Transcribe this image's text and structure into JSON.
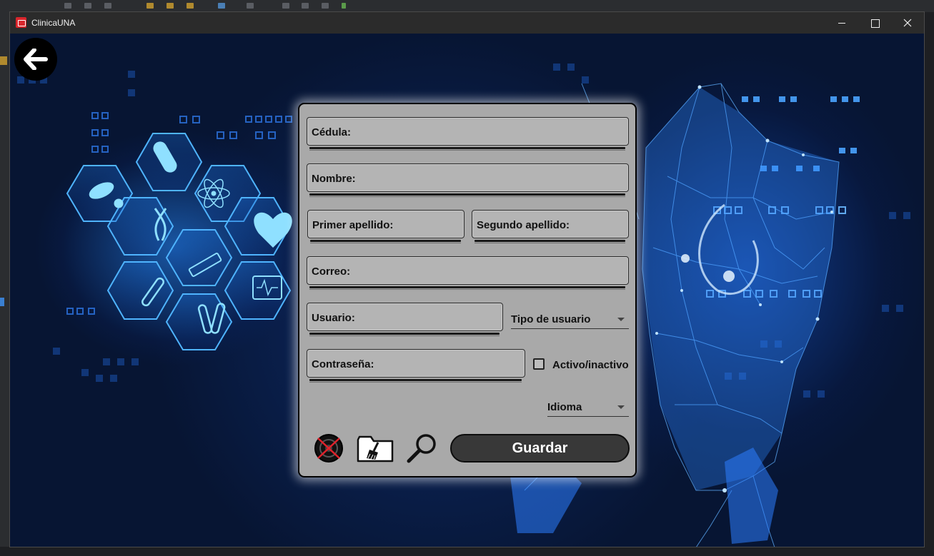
{
  "window": {
    "title": "ClinicaUNA"
  },
  "form": {
    "cedula_label": "Cédula:",
    "nombre_label": "Nombre:",
    "primer_apellido_label": "Primer apellido:",
    "segundo_apellido_label": "Segundo apellido:",
    "correo_label": "Correo:",
    "usuario_label": "Usuario:",
    "tipo_usuario_label": "Tipo de usuario",
    "contrasena_label": "Contraseña:",
    "activo_label": "Activo/inactivo",
    "activo_checked": false,
    "idioma_label": "Idioma",
    "save_label": "Guardar"
  },
  "icons": {
    "back": "back-arrow-icon",
    "delete": "delete-icon",
    "clean": "clean-folder-broom-icon",
    "search": "search-magnifier-icon"
  },
  "colors": {
    "panel": "#a9a9a9",
    "field": "#b4b4b4",
    "save_button": "#383838",
    "background": "#0a1633",
    "accent_glow": "#2a8cff"
  }
}
